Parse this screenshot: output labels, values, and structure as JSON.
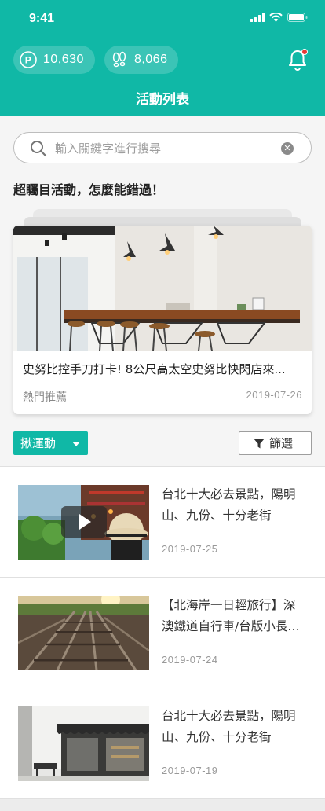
{
  "status": {
    "time": "9:41"
  },
  "header": {
    "points_value": "10,630",
    "steps_value": "8,066",
    "title": "活動列表",
    "accent_color": "#10b8a6",
    "notification_dot_color": "#e53935"
  },
  "search": {
    "placeholder": "輸入關鍵字進行搜尋",
    "value": ""
  },
  "featured": {
    "section_title": "超矚目活動，怎麼能錯過！",
    "card": {
      "title": "史努比控手刀打卡! 8公尺高太空史努比快閃店來...",
      "tag": "熱門推薦",
      "date": "2019-07-26"
    }
  },
  "filters": {
    "category": "揪運動",
    "filter_label": "篩選"
  },
  "articles": [
    {
      "title": "台北十大必去景點，陽明山、九份、十分老街",
      "date": "2019-07-25",
      "has_video": true
    },
    {
      "title": "【北海岸一日輕旅行】深澳鐵道自行車/台版小長城...",
      "date": "2019-07-24",
      "has_video": false
    },
    {
      "title": "台北十大必去景點，陽明山、九份、十分老街",
      "date": "2019-07-19",
      "has_video": false
    }
  ]
}
